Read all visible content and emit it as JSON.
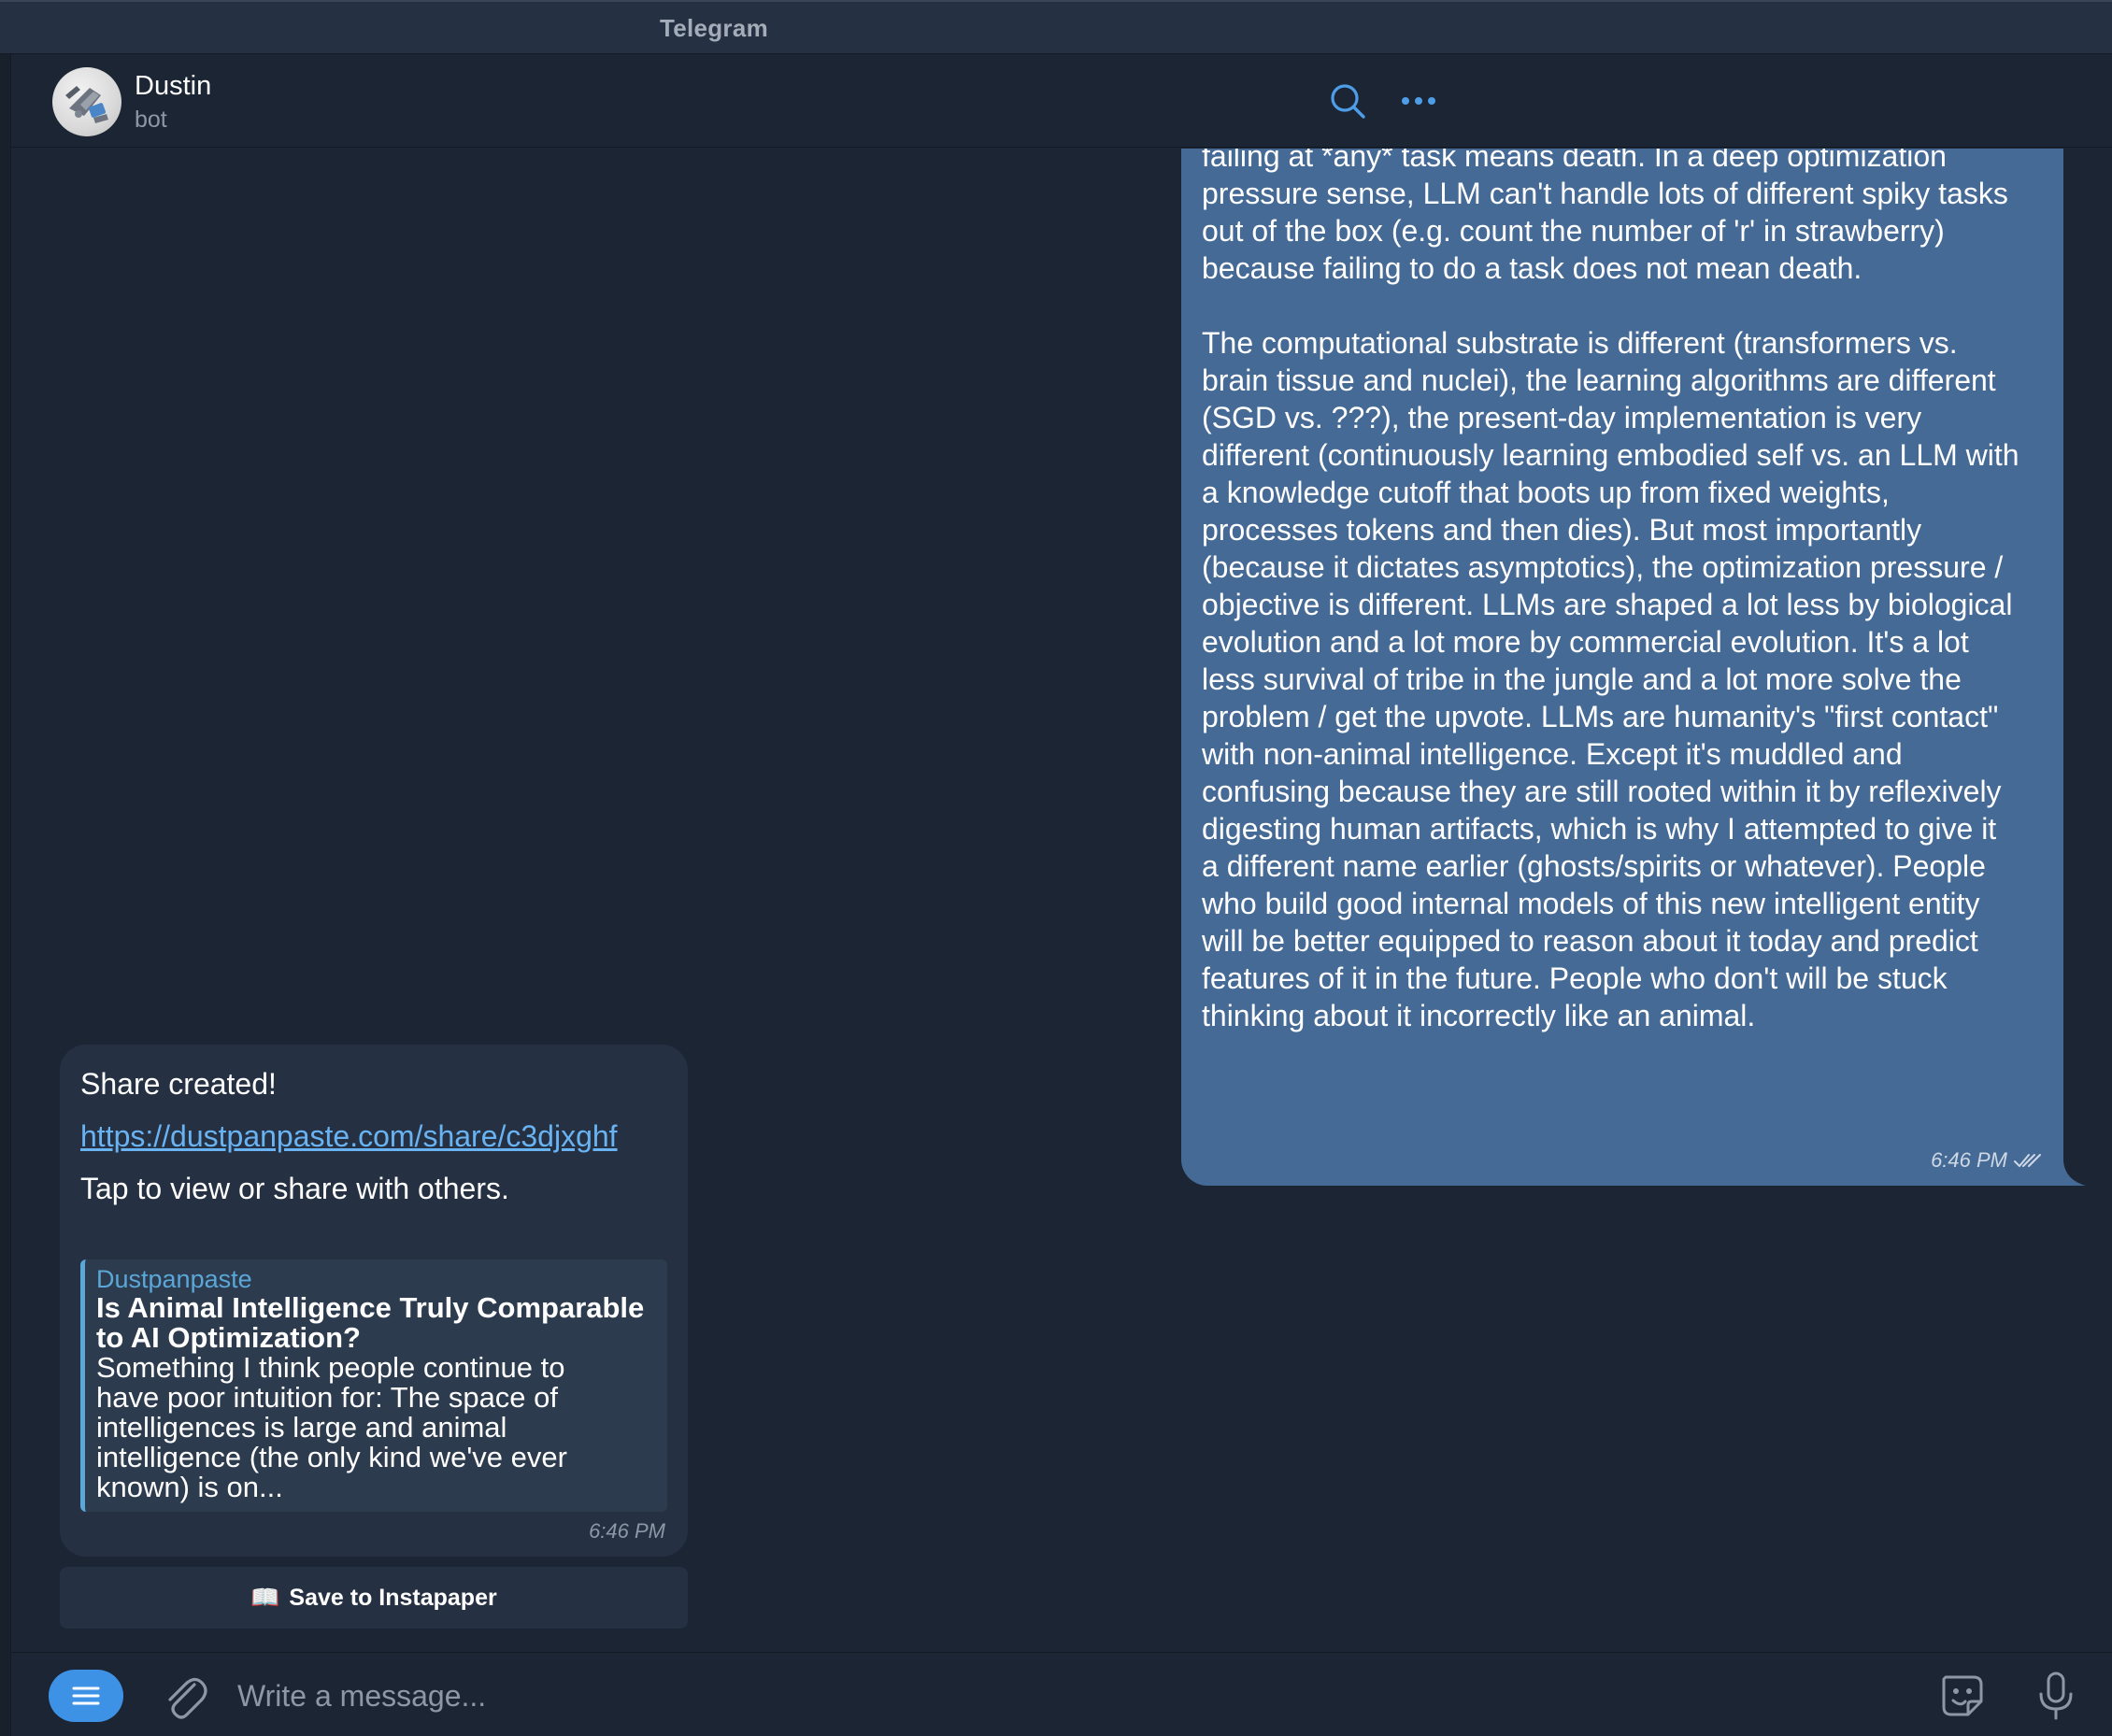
{
  "window": {
    "title": "Telegram"
  },
  "header": {
    "name": "Dustin",
    "status": "bot",
    "search_icon": "search-icon",
    "more_icon": "more-dots-icon"
  },
  "outgoing_message": {
    "text_lines": [
      "failing at *any* task means death. In a deep optimization",
      "pressure sense, LLM can't handle lots of different spiky tasks",
      "out of the box (e.g. count the number of 'r' in strawberry)",
      "because failing to do a task does not mean death.",
      "",
      "The computational substrate is different (transformers vs.",
      "brain tissue and nuclei), the learning algorithms are different",
      "(SGD vs. ???), the present-day implementation is very",
      "different (continuously learning embodied self vs. an LLM with",
      "a knowledge cutoff that boots up from fixed weights,",
      "processes tokens and then dies). But most importantly",
      "(because it dictates asymptotics), the optimization pressure /",
      "objective is different. LLMs are shaped a lot less by biological",
      "evolution and a lot more by commercial evolution. It's a lot",
      "less survival of tribe in the jungle and a lot more solve the",
      "problem / get the upvote. LLMs are humanity's \"first contact\"",
      "with non-animal intelligence. Except it's muddled and",
      "confusing because they are still rooted within it by reflexively",
      "digesting human artifacts, which is why I attempted to give it",
      "a different name earlier (ghosts/spirits or whatever). People",
      "who build good internal models of this new intelligent entity",
      "will be better equipped to reason about it today and predict",
      "features of it in the future. People who don't will be stuck",
      "thinking about it incorrectly like an animal."
    ],
    "time": "6:46 PM",
    "status_icon": "double-check-icon"
  },
  "incoming_message": {
    "line1": "Share created!",
    "link": "https://dustpanpaste.com/share/c3djxghf",
    "line3": "Tap to view or share with others.",
    "preview": {
      "site": "Dustpanpaste",
      "title_lines": [
        "Is Animal Intelligence Truly Comparable",
        "to AI Optimization?"
      ],
      "desc_lines": [
        "Something I think people continue to",
        "have poor intuition for: The space of",
        "intelligences is large and animal",
        "intelligence (the only kind we've ever",
        "known) is on..."
      ]
    },
    "time": "6:46 PM"
  },
  "inline_button": {
    "emoji": "📖",
    "label": "Save to Instapaper"
  },
  "composer": {
    "placeholder": "Write a message...",
    "menu_icon": "menu-icon",
    "attach_icon": "paperclip-icon",
    "sticker_icon": "sticker-icon",
    "mic_icon": "microphone-icon"
  },
  "colors": {
    "background": "#1c2533",
    "outgoing_bubble": "#456a95",
    "incoming_bubble": "#253142",
    "accent": "#3e92e6",
    "link": "#6ab3f3"
  }
}
